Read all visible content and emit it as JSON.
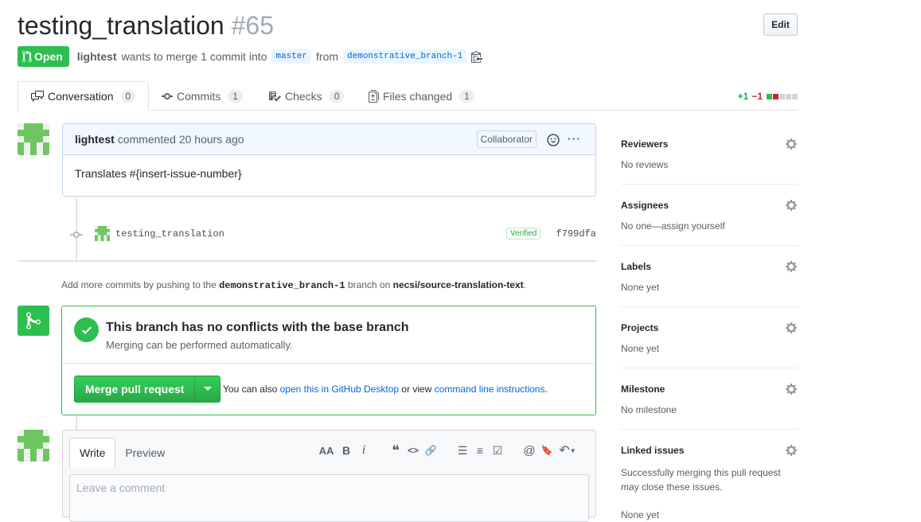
{
  "pr": {
    "title": "testing_translation",
    "number": "#65",
    "edit_label": "Edit",
    "state": "Open",
    "author": "lightest",
    "summary": "wants to merge 1 commit into",
    "base_branch": "master",
    "from_word": "from",
    "head_branch": "demonstrative_branch-1"
  },
  "tabs": [
    {
      "label": "Conversation",
      "count": "0"
    },
    {
      "label": "Commits",
      "count": "1"
    },
    {
      "label": "Checks",
      "count": "0"
    },
    {
      "label": "Files changed",
      "count": "1"
    }
  ],
  "diffstat": {
    "add": "+1",
    "del": "−1"
  },
  "comment": {
    "author": "lightest",
    "time": "commented 20 hours ago",
    "role": "Collaborator",
    "more": "···",
    "body": "Translates #{insert-issue-number}"
  },
  "commit": {
    "message": "testing_translation",
    "verified": "Verified",
    "sha": "f799dfa"
  },
  "push_info": {
    "prefix": "Add more commits by pushing to the",
    "branch": "demonstrative_branch-1",
    "middle": "branch on",
    "repo": "necsi/source-translation-text",
    "suffix": "."
  },
  "merge": {
    "title": "This branch has no conflicts with the base branch",
    "subtitle": "Merging can be performed automatically.",
    "button": "Merge pull request",
    "alt_prefix": "You can also",
    "alt_link1": "open this in GitHub Desktop",
    "alt_middle": "or view",
    "alt_link2": "command line instructions",
    "alt_suffix": "."
  },
  "editor": {
    "tab_write": "Write",
    "tab_preview": "Preview",
    "placeholder": "Leave a comment",
    "tools": {
      "heading": "AA",
      "bold": "B",
      "italic": "i",
      "quote": "❝",
      "code": "<>",
      "link": "🔗",
      "ul": "☰",
      "ol": "≡",
      "task": "☑",
      "mention": "@",
      "saved": "🔖",
      "reply": "↶"
    }
  },
  "sidebar": [
    {
      "title": "Reviewers",
      "value": "No reviews"
    },
    {
      "title": "Assignees",
      "value": "No one—assign yourself"
    },
    {
      "title": "Labels",
      "value": "None yet"
    },
    {
      "title": "Projects",
      "value": "None yet"
    },
    {
      "title": "Milestone",
      "value": "No milestone"
    }
  ],
  "linked_issues": {
    "title": "Linked issues",
    "description": "Successfully merging this pull request may close these issues.",
    "value": "None yet"
  },
  "colors": {
    "green": "#2cbe4e",
    "blue_link": "#0366d6",
    "red": "#cb2431"
  }
}
